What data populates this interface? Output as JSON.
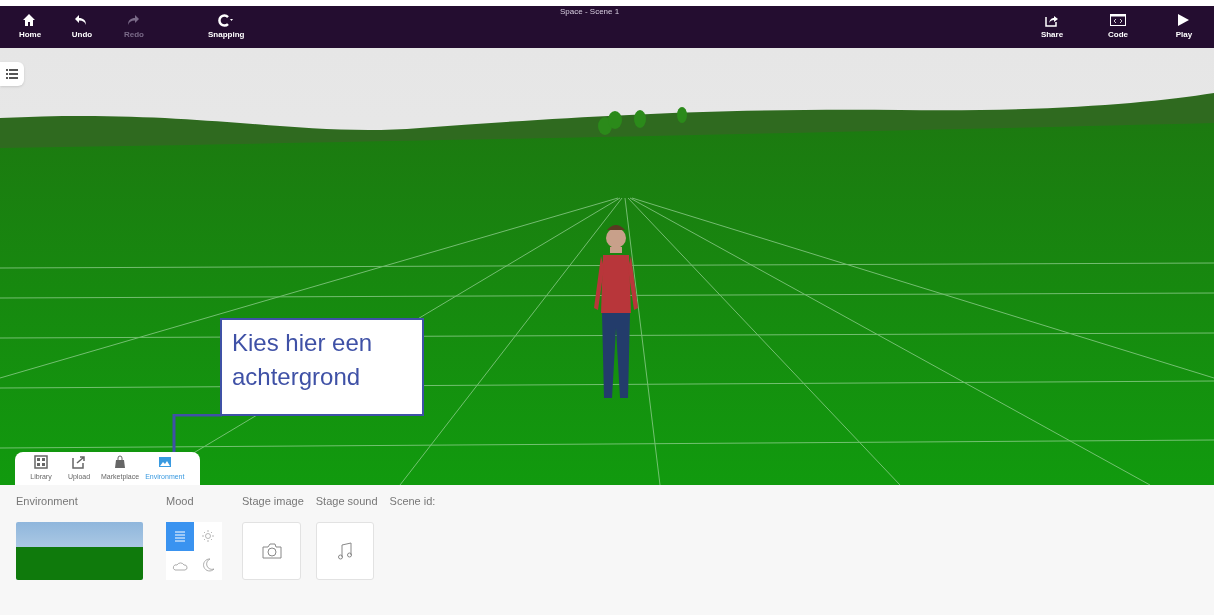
{
  "window": {
    "title": "Space - Scene 1"
  },
  "toolbar_left": [
    {
      "kind": "home",
      "label": "Home",
      "disabled": false
    },
    {
      "kind": "undo",
      "label": "Undo",
      "disabled": false
    },
    {
      "kind": "redo",
      "label": "Redo",
      "disabled": true
    },
    {
      "kind": "snapping",
      "label": "Snapping",
      "disabled": false
    }
  ],
  "toolbar_right": [
    {
      "kind": "share",
      "label": "Share"
    },
    {
      "kind": "code",
      "label": "Code"
    },
    {
      "kind": "play",
      "label": "Play"
    }
  ],
  "callout": {
    "text": "Kies hier een achtergrond"
  },
  "scene_tabs": [
    {
      "kind": "library",
      "label": "Library",
      "selected": false
    },
    {
      "kind": "upload",
      "label": "Upload",
      "selected": false
    },
    {
      "kind": "marketplace",
      "label": "Marketplace",
      "selected": false
    },
    {
      "kind": "environment",
      "label": "Environment",
      "selected": true
    }
  ],
  "panel": {
    "environment_label": "Environment",
    "mood_label": "Mood",
    "stage_image_label": "Stage image",
    "stage_sound_label": "Stage sound",
    "scene_id_label": "Scene id:",
    "moods": [
      {
        "kind": "default",
        "selected": true
      },
      {
        "kind": "sunny",
        "selected": false
      },
      {
        "kind": "cloudy",
        "selected": false
      },
      {
        "kind": "night",
        "selected": false
      }
    ]
  }
}
